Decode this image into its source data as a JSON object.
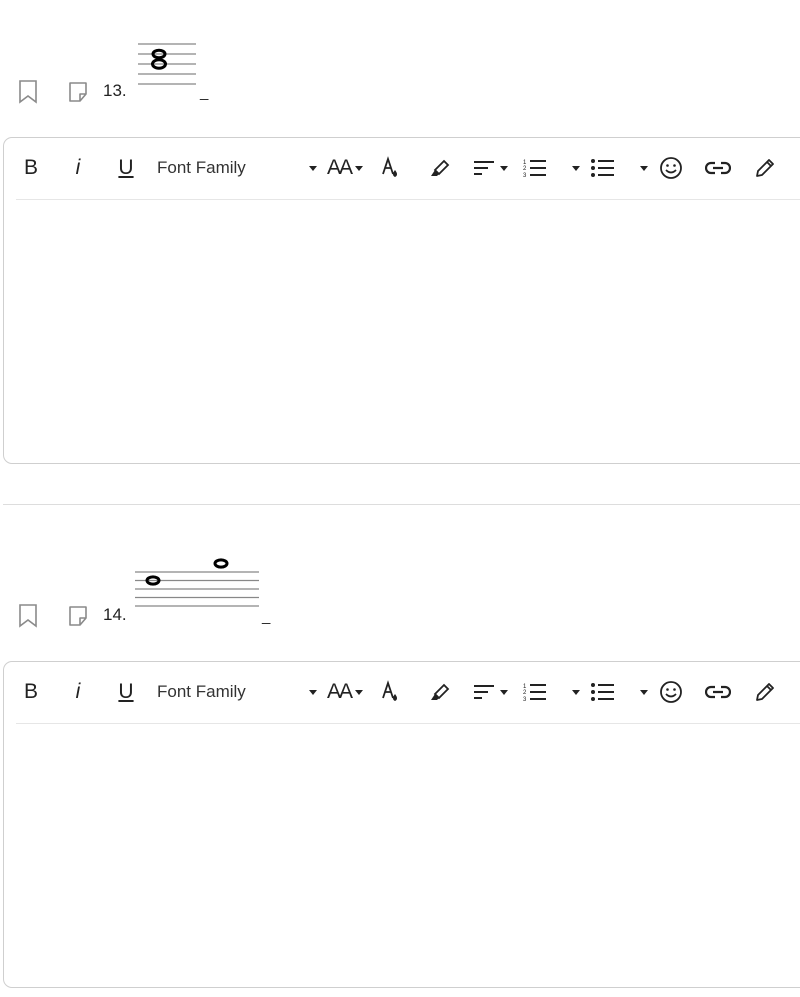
{
  "questions": [
    {
      "number": "13.",
      "answer_blank": "_",
      "notation": "chord of two whole notes on treble staff"
    },
    {
      "number": "14.",
      "answer_blank": "_",
      "notation": "two whole notes forming an interval"
    }
  ],
  "toolbar": {
    "bold": "B",
    "italic": "i",
    "underline": "U",
    "font_family": "Font Family",
    "font_size": "AA"
  },
  "colors": {
    "border": "#cfcfcf",
    "icon": "#222222",
    "muted_icon": "#8a8a8a"
  }
}
